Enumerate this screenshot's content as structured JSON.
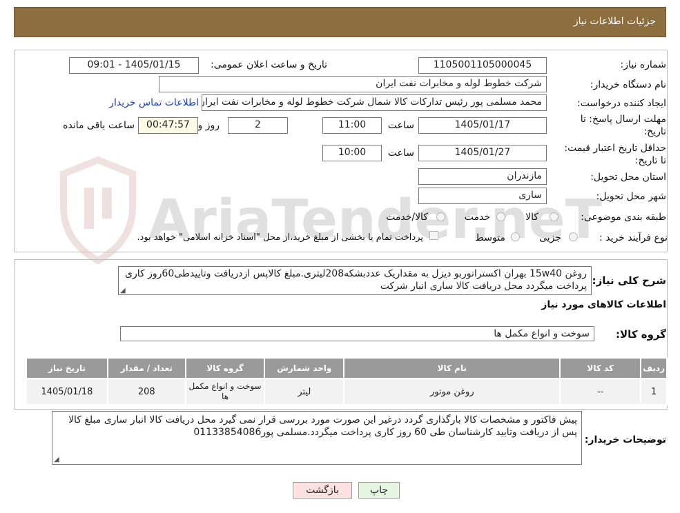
{
  "header": {
    "title": "جزئیات اطلاعات نیاز"
  },
  "watermark": {
    "text": "AriaTender.neT"
  },
  "details": {
    "need_number_label": "شماره نیاز:",
    "need_number": "1105001105000045",
    "announce_label": "تاریخ و ساعت اعلان عمومی:",
    "announce_value": "1405/01/15 - 09:01",
    "buyer_label": "نام دستگاه خریدار:",
    "buyer_value": "شرکت خطوط لوله و مخابرات نفت ایران",
    "creator_label": "ایجاد کننده درخواست:",
    "creator_value": "محمد مسلمی پور رئیس تدارکات کالا شمال شرکت خطوط لوله و مخابرات نفت ایران",
    "contact_link": "اطلاعات تماس خریدار",
    "deadline_label": "مهلت ارسال پاسخ: تا تاریخ:",
    "deadline_date": "1405/01/17",
    "time_label": "ساعت",
    "deadline_time": "11:00",
    "days_value": "2",
    "days_label": "روز و",
    "remaining_value": "00:47:57",
    "remaining_label": "ساعت باقی مانده",
    "validity_label": "حداقل تاریخ اعتبار قیمت: تا تاریخ:",
    "validity_date": "1405/01/27",
    "validity_time": "10:00",
    "province_label": "استان محل تحویل:",
    "province_value": "مازندران",
    "city_label": "شهر محل تحویل:",
    "city_value": "ساری",
    "category_label": "طبقه بندی موضوعی:",
    "category_options": [
      "کالا",
      "خدمت",
      "کالا/خدمت"
    ],
    "process_label": "نوع فرآیند خرید :",
    "process_options": [
      "جزیی",
      "متوسط"
    ],
    "process_note": "پرداخت تمام یا بخشی از مبلغ خرید،از محل \"اسناد خزانه اسلامی\" خواهد بود."
  },
  "summary": {
    "label": "شرح کلی نیاز:",
    "text": "روغن 15w40 بهران اکستراتوربو دیزل به مقداریک عددبشکه208لیتری.مبلغ کالاپس ازدریافت وتاییدطی60روز کاری پرداخت میگردد محل دریافت کالا ساری انبار شرکت",
    "goods_info_title": "اطلاعات کالاهای مورد نیاز",
    "group_label": "گروه کالا:",
    "group_value": "سوخت و انواع مکمل ها"
  },
  "table": {
    "headers": [
      "ردیف",
      "کد کالا",
      "نام کالا",
      "واحد شمارش",
      "گروه کالا",
      "تعداد / مقدار",
      "تاریخ نیاز"
    ],
    "rows": [
      [
        "1",
        "--",
        "روغن موتور",
        "لیتر",
        "سوخت و انواع مکمل ها",
        "208",
        "1405/01/18"
      ]
    ]
  },
  "buyer_notes": {
    "label": "توضیحات خریدار:",
    "text": "پیش فاکتور و مشخصات کالا بارگذاری گردد درغیر این صورت مورد بررسی قرار نمی گیرد محل دریافت کالا انبار ساری مبلغ کالا پس از دریافت وتایید کارشناسان طی 60 روز کاری پرداخت میگردد.مسلمی پور01133854086"
  },
  "buttons": {
    "print": "چاپ",
    "back": "بازگشت"
  },
  "colors": {
    "header_bg": "#8d6e3f",
    "table_header_bg": "#9a9a9a",
    "back_button_bg": "#fde0e0",
    "print_button_bg": "#e6f5df"
  }
}
